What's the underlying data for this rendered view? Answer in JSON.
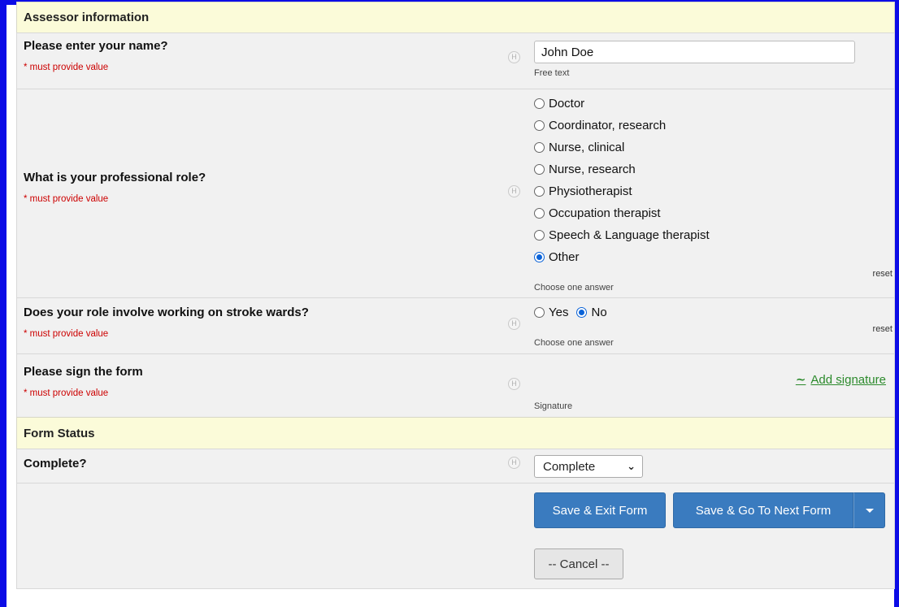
{
  "sections": {
    "assessor": "Assessor information",
    "status": "Form Status"
  },
  "help_icon_glyph": "H",
  "name_q": {
    "label": "Please enter your name?",
    "required": "* must provide value",
    "value": "John Doe",
    "note": "Free text"
  },
  "role_q": {
    "label": "What is your professional role?",
    "required": "* must provide value",
    "options": [
      "Doctor",
      "Coordinator, research",
      "Nurse, clinical",
      "Nurse, research",
      "Physiotherapist",
      "Occupation therapist",
      "Speech & Language therapist",
      "Other"
    ],
    "selected": "Other",
    "note": "Choose one answer",
    "reset": "reset"
  },
  "stroke_q": {
    "label": "Does your role involve working on stroke wards?",
    "required": "* must provide value",
    "options": [
      "Yes",
      "No"
    ],
    "selected": "No",
    "note": "Choose one answer",
    "reset": "reset"
  },
  "sign_q": {
    "label": "Please sign the form",
    "required": "* must provide value",
    "link": "Add signature",
    "note": "Signature"
  },
  "complete_q": {
    "label": "Complete?",
    "value": "Complete"
  },
  "buttons": {
    "save_exit": "Save & Exit Form",
    "save_next": "Save & Go To Next Form",
    "cancel": "-- Cancel --"
  },
  "colors": {
    "frame": "#0c0ce6",
    "section_bg": "#fbfbd9",
    "row_bg": "#f1f1f1",
    "required": "#cc0000",
    "primary_button": "#3a7bbf",
    "signature_link": "#2c8a2c",
    "radio_checked": "#0b63d8"
  }
}
